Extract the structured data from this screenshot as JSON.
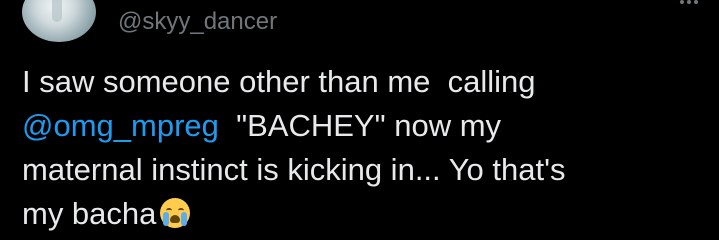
{
  "tweet": {
    "display_name_fragment": "",
    "handle": "@skyy_dancer",
    "avatar_icon": "avatar-photo-dancer",
    "more_icon": "more-options-icon",
    "text": {
      "part1": "I saw someone other than me  calling\n",
      "mention": "@omg_mpreg",
      "part2": "  \"BACHEY\" now my\nmaternal instinct is kicking in... Yo that's\nmy bacha",
      "emoji_name": "loudly-crying-face-icon"
    }
  },
  "colors": {
    "background": "#000000",
    "text": "#e7e9ea",
    "secondary": "#71767b",
    "link": "#1d9bf0"
  }
}
